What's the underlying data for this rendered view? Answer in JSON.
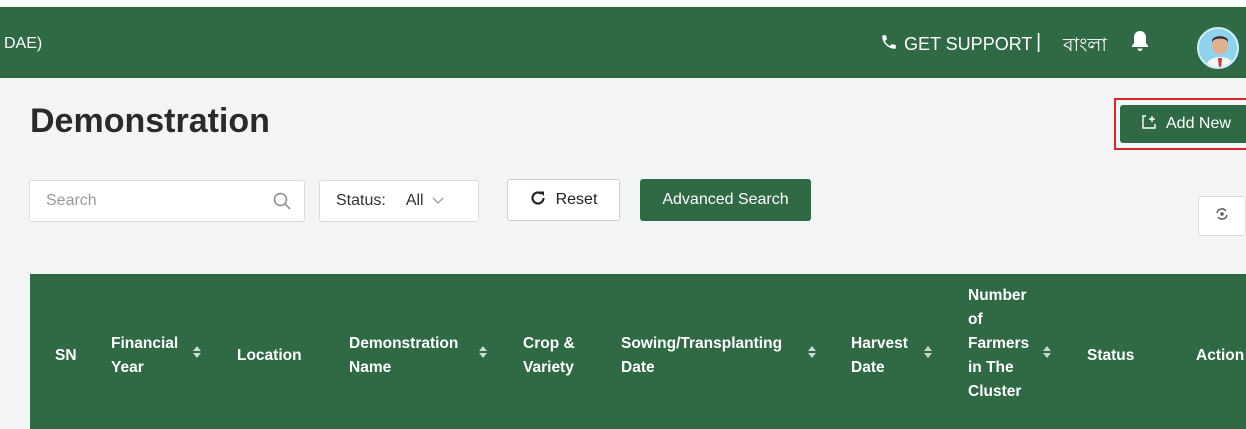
{
  "header": {
    "org_fragment": "DAE)",
    "support_label": "GET SUPPORT",
    "separator": "|",
    "language_label": "বাংলা"
  },
  "page": {
    "title": "Demonstration",
    "add_new_label": "Add New"
  },
  "filters": {
    "search_placeholder": "Search",
    "status_label": "Status:",
    "status_value": "All",
    "reset_label": "Reset",
    "advanced_search_label": "Advanced Search"
  },
  "table": {
    "columns": [
      {
        "line1": "SN",
        "line2": ""
      },
      {
        "line1": "Financial",
        "line2": "Year"
      },
      {
        "line1": "Location",
        "line2": ""
      },
      {
        "line1": "Demonstration",
        "line2": "Name"
      },
      {
        "line1": "Crop &",
        "line2": "Variety"
      },
      {
        "line1": "Sowing/Transplanting",
        "line2": "Date"
      },
      {
        "line1": "Harvest",
        "line2": "Date"
      },
      {
        "line1": "Number",
        "line2": "of",
        "line3": "Farmers",
        "line4": "in The",
        "line5": "Cluster"
      },
      {
        "line1": "Status",
        "line2": ""
      },
      {
        "line1": "Action",
        "line2": ""
      }
    ]
  },
  "colors": {
    "brand_green": "#2f6a45",
    "highlight_red": "#d62828",
    "page_background": "#f3f4f6"
  },
  "icons": [
    "phone-icon",
    "bell-icon",
    "avatar",
    "add-icon",
    "search-icon",
    "chevron-down-icon",
    "reset-icon",
    "refresh-icon",
    "sort-icon"
  ]
}
